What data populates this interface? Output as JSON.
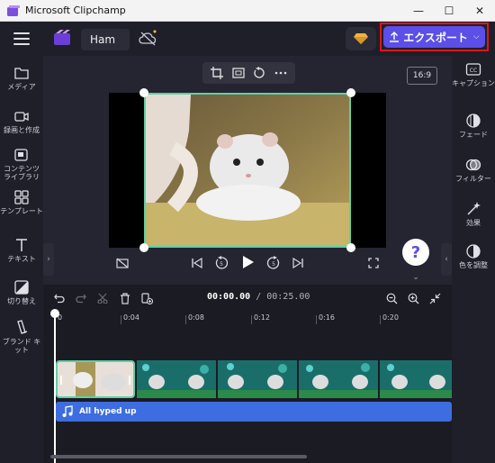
{
  "window": {
    "title": "Microsoft Clipchamp",
    "minimize": "—",
    "maximize": "☐",
    "close": "✕"
  },
  "header": {
    "project_name": "Ham",
    "export_label": "エクスポート",
    "export_chevron": "⌵",
    "accent_color": "#5b4fe8",
    "highlight_color": "#e0141a"
  },
  "left_sidebar": {
    "items": [
      {
        "label": "メディア",
        "icon": "folder-icon"
      },
      {
        "label": "録画と作成",
        "icon": "video-camera-icon"
      },
      {
        "label": "コンテンツ\nライブラリ",
        "icon": "content-library-icon"
      },
      {
        "label": "テンプレート",
        "icon": "templates-icon"
      },
      {
        "label": "テキスト",
        "icon": "text-icon"
      },
      {
        "label": "切り替え",
        "icon": "transitions-icon"
      },
      {
        "label": "ブランド キット",
        "icon": "brand-kit-icon"
      }
    ]
  },
  "right_sidebar": {
    "items": [
      {
        "label": "キャプション",
        "icon": "captions-icon"
      },
      {
        "label": "フェード",
        "icon": "fade-icon"
      },
      {
        "label": "フィルター",
        "icon": "filters-icon"
      },
      {
        "label": "効果",
        "icon": "effects-icon"
      },
      {
        "label": "色を調整",
        "icon": "adjust-color-icon"
      }
    ]
  },
  "preview": {
    "aspect_ratio": "16:9",
    "help": "?"
  },
  "timeline": {
    "current_time": "00:00.00",
    "separator": " / ",
    "duration": "00:25.00",
    "ruler_labels": [
      "0",
      "0:04",
      "0:08",
      "0:12",
      "0:16",
      "0:20"
    ],
    "audio_clip_label": "All hyped up"
  }
}
